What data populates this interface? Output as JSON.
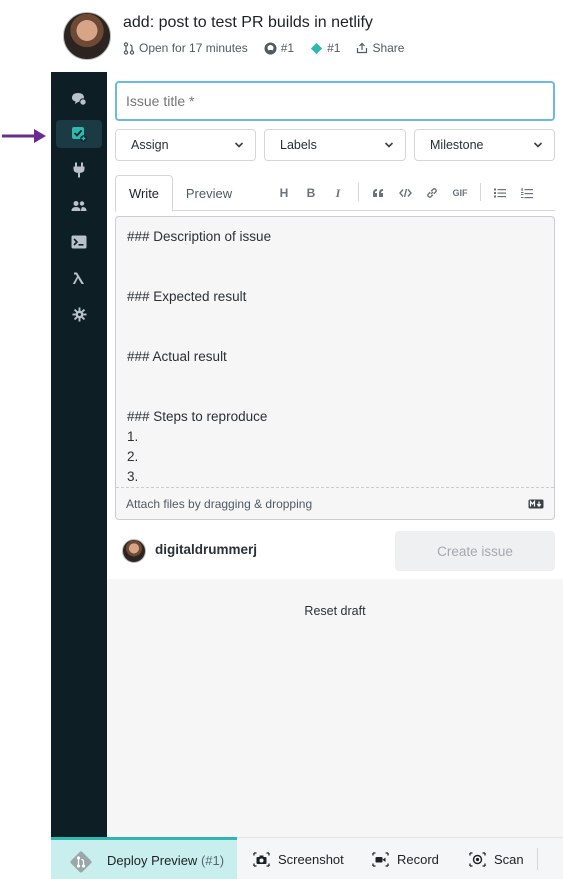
{
  "header": {
    "title": "add: post to test PR builds in netlify",
    "status": "Open for 17 minutes",
    "github_pr": "#1",
    "deploy_pr": "#1",
    "share": "Share"
  },
  "sidebar": {
    "items": [
      {
        "icon": "chat-bubbles-icon"
      },
      {
        "icon": "new-issue-icon",
        "active": true
      },
      {
        "icon": "plug-icon"
      },
      {
        "icon": "users-icon"
      },
      {
        "icon": "terminal-icon"
      },
      {
        "icon": "lambda-icon"
      },
      {
        "icon": "gear-icon"
      }
    ]
  },
  "form": {
    "title_placeholder": "Issue title *",
    "assign": "Assign",
    "labels": "Labels",
    "milestone": "Milestone",
    "tab_write": "Write",
    "tab_preview": "Preview",
    "toolbar": {
      "heading": "H",
      "bold": "B",
      "italic": "I",
      "gif": "GIF"
    },
    "body": "### Description of issue\n\n\n### Expected result\n\n\n### Actual result\n\n\n### Steps to reproduce\n1.\n2.\n3.",
    "attach_hint": "Attach files by dragging & dropping",
    "username": "digitaldrummerj",
    "create_button": "Create issue",
    "reset_draft": "Reset draft"
  },
  "bottombar": {
    "deploy_preview": "Deploy Preview",
    "deploy_number": "(#1)",
    "screenshot": "Screenshot",
    "record": "Record",
    "scan": "Scan"
  },
  "colors": {
    "sidebar_bg": "#0e1e25",
    "accent_teal": "#2fb8b0",
    "arrow_purple": "#6b2c91",
    "focus_blue": "#6cb8e8"
  }
}
